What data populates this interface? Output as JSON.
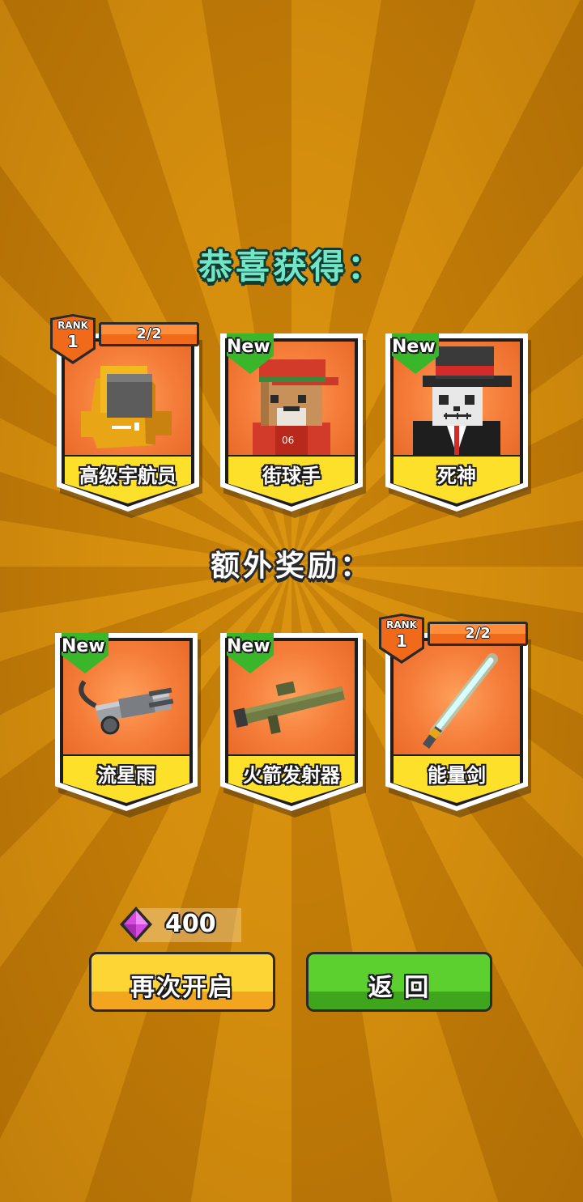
{
  "title": "恭喜获得：",
  "bonus_title": "额外奖励：",
  "rewards": [
    {
      "name": "高级宇航员",
      "badge": "rank",
      "rank_label": "RANK",
      "rank": "1",
      "count": "2/2",
      "icon": "astronaut-character-icon"
    },
    {
      "name": "街球手",
      "badge": "new",
      "badge_label": "New",
      "icon": "street-baller-character-icon"
    },
    {
      "name": "死神",
      "badge": "new",
      "badge_label": "New",
      "icon": "grim-reaper-character-icon"
    }
  ],
  "bonus": [
    {
      "name": "流星雨",
      "badge": "new",
      "badge_label": "New",
      "icon": "minigun-weapon-icon"
    },
    {
      "name": "火箭发射器",
      "badge": "new",
      "badge_label": "New",
      "icon": "rocket-launcher-weapon-icon"
    },
    {
      "name": "能量剑",
      "badge": "rank",
      "rank_label": "RANK",
      "rank": "1",
      "count": "2/2",
      "icon": "energy-sword-weapon-icon"
    }
  ],
  "currency": {
    "amount": "400",
    "icon": "gem-icon",
    "color": "#d54adf"
  },
  "buttons": {
    "reopen_label": "再次开启",
    "back_label": "返 回"
  },
  "colors": {
    "background": "#c98309",
    "card_art": "#f57d3a",
    "label_bg": "#fde02a",
    "new_badge": "#39b62a",
    "rank_badge": "#f06a1a"
  }
}
